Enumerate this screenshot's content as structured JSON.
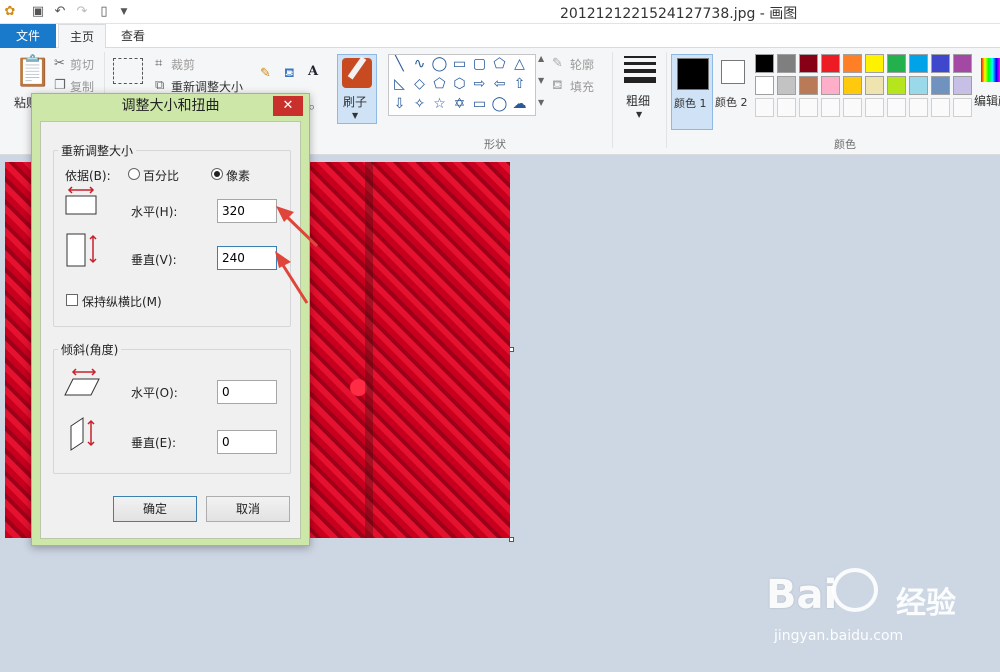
{
  "window": {
    "title": "2012121221524127738.jpg - 画图"
  },
  "quick_access": [
    "save-icon",
    "undo-icon",
    "redo-icon",
    "new-file-icon",
    "dropdown-icon"
  ],
  "tabs": {
    "file": "文件",
    "home": "主页",
    "view": "查看"
  },
  "ribbon": {
    "clipboard": {
      "paste": "粘贴",
      "cut": "剪切",
      "copy": "复制"
    },
    "image": {
      "crop": "裁剪",
      "resize": "重新调整大小"
    },
    "brush": {
      "label": "刷子"
    },
    "shapes": {
      "outline": "轮廓",
      "fill": "填充",
      "group_label": "形状"
    },
    "size": {
      "label": "粗细"
    },
    "colors": {
      "color1": "颜色 1",
      "color2": "颜色 2",
      "edit": "编辑颜",
      "group_label": "颜色",
      "color1_value": "#000000",
      "color2_value": "#ffffff",
      "palette_row1": [
        "#000000",
        "#7f7f7f",
        "#880015",
        "#ed1c24",
        "#ff7f27",
        "#fff200",
        "#22b14c",
        "#00a2e8",
        "#3f48cc",
        "#a349a4"
      ],
      "palette_row2": [
        "#ffffff",
        "#c3c3c3",
        "#b97a57",
        "#ffaec9",
        "#ffc90e",
        "#efe4b0",
        "#b5e61d",
        "#99d9ea",
        "#7092be",
        "#c8bfe7"
      ]
    }
  },
  "dialog": {
    "title": "调整大小和扭曲",
    "resize": {
      "legend": "重新调整大小",
      "by_label": "依据(B):",
      "percent_label": "百分比",
      "pixels_label": "像素",
      "selected": "pixels",
      "horizontal_label": "水平(H):",
      "horizontal_value": "320",
      "vertical_label": "垂直(V):",
      "vertical_value": "240",
      "keep_ratio_label": "保持纵横比(M)",
      "keep_ratio_checked": false
    },
    "skew": {
      "legend": "倾斜(角度)",
      "horizontal_label": "水平(O):",
      "horizontal_value": "0",
      "vertical_label": "垂直(E):",
      "vertical_value": "0"
    },
    "ok": "确定",
    "cancel": "取消"
  },
  "watermark": {
    "logo": "Bai",
    "logo2": "经验",
    "url": "jingyan.baidu.com"
  }
}
